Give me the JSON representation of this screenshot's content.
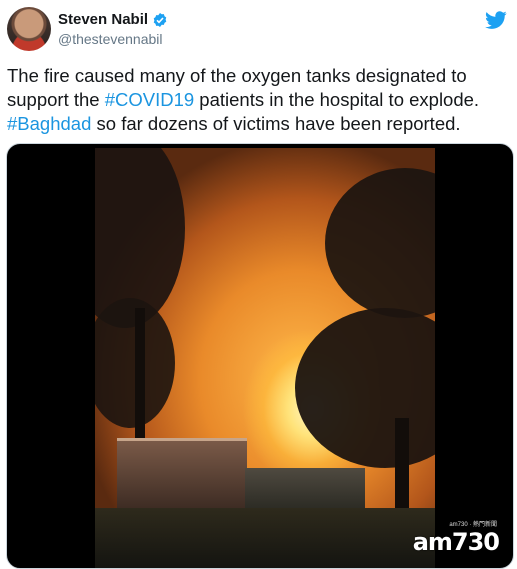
{
  "author": {
    "name": "Steven Nabil",
    "handle": "@thestevennabil"
  },
  "tweet": {
    "text_part1": "The fire caused many of the oxygen tanks designated to support the ",
    "hashtag1": "#COVID19",
    "text_part2": " patients in the hospital to explode. ",
    "hashtag2": "#Baghdad",
    "text_part3": " so far dozens of victims have been reported."
  },
  "media": {
    "watermark": "am730",
    "watermark_small": "am730 · 熱門新聞"
  },
  "colors": {
    "hashtag": "#1b95e0",
    "twitter_blue": "#1da1f2",
    "handle_gray": "#657786"
  },
  "icons": [
    "verified-badge-icon",
    "twitter-bird-icon"
  ]
}
